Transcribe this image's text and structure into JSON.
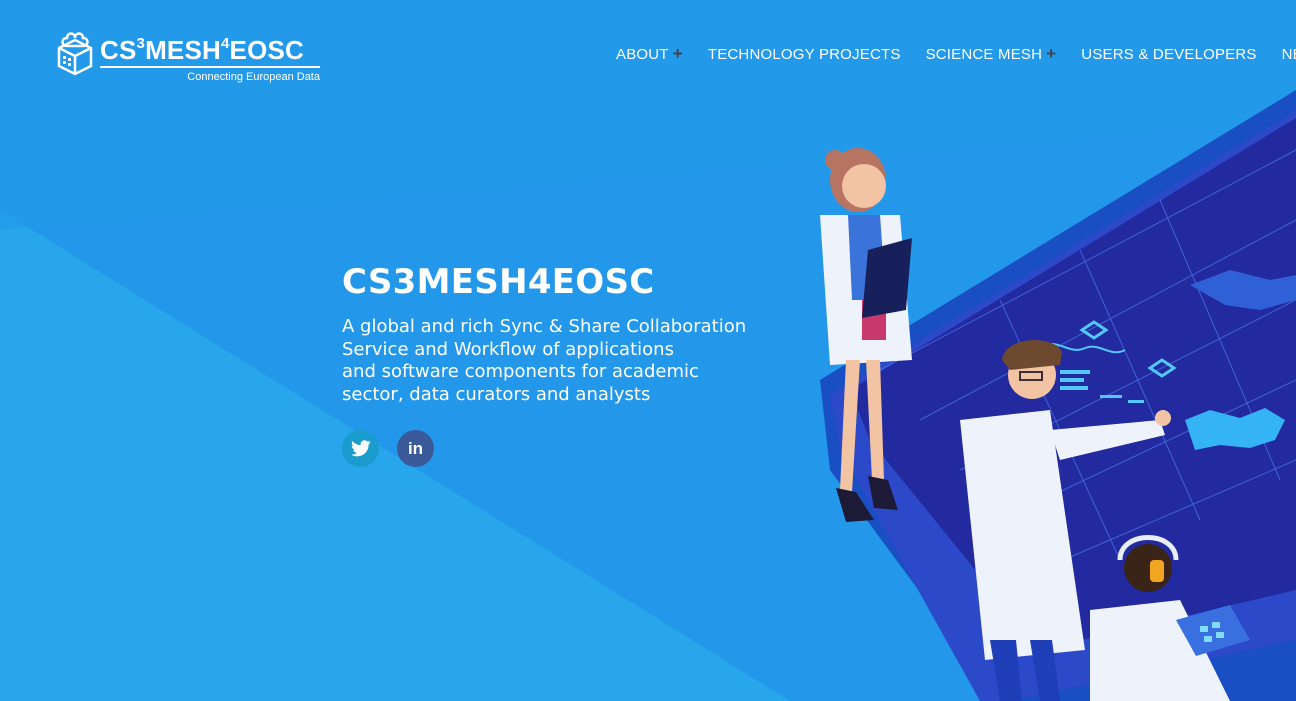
{
  "brand": {
    "name_parts": [
      "CS",
      "3",
      "MESH",
      "4",
      "EOSC"
    ],
    "tagline": "Connecting European Data"
  },
  "nav": {
    "items": [
      {
        "label": "ABOUT",
        "has_submenu": true
      },
      {
        "label": "TECHNOLOGY PROJECTS",
        "has_submenu": false
      },
      {
        "label": "SCIENCE MESH",
        "has_submenu": true
      },
      {
        "label": "USERS & DEVELOPERS",
        "has_submenu": false
      },
      {
        "label": "NEWS",
        "has_submenu": false
      }
    ],
    "submenu_glyph": "+"
  },
  "hero": {
    "title": "CS3MESH4EOSC",
    "description_lines": [
      "A global and rich Sync & Share Collaboration",
      "Service and Workflow of applications",
      "and software components for academic",
      "sector, data curators and analysts"
    ]
  },
  "social": {
    "twitter_icon": "twitter-bird-icon",
    "linkedin_label": "in"
  },
  "colors": {
    "background": "#2a9ee9",
    "twitter": "#1a9ccc",
    "linkedin": "#3a5a9a",
    "platform": "#1e3fb8",
    "submenu_plus": "#444444"
  }
}
